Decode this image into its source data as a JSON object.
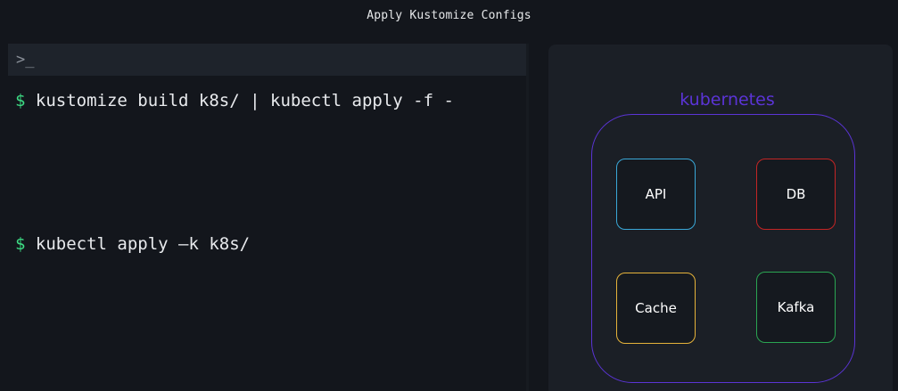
{
  "window": {
    "title": "Apply Kustomize Configs"
  },
  "terminal": {
    "prompt_glyph": ">_",
    "lines": [
      {
        "prompt": "$",
        "command": "kustomize build k8s/ | kubectl apply -f -"
      },
      {
        "prompt": "$",
        "command": "kubectl apply –k k8s/"
      }
    ]
  },
  "cluster": {
    "label": "kubernetes",
    "services": [
      {
        "label": "API",
        "color": "#3aa8d8"
      },
      {
        "label": "DB",
        "color": "#c42525"
      },
      {
        "label": "Cache",
        "color": "#e6b33a"
      },
      {
        "label": "Kafka",
        "color": "#2aa552"
      }
    ]
  },
  "colors": {
    "background": "#13161c",
    "terminal_bar": "#1e232b",
    "prompt": "#3ddc84",
    "cluster_border": "#5b34d6"
  }
}
